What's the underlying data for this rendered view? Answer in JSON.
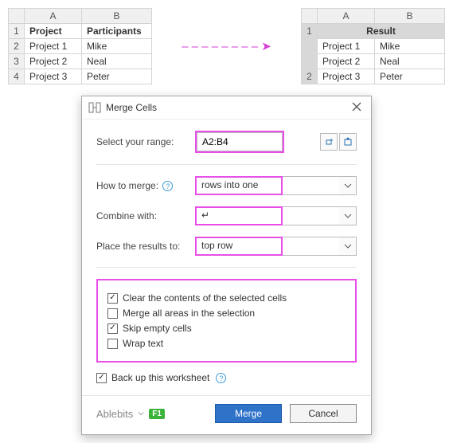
{
  "left_table": {
    "col_headers": [
      "",
      "A",
      "B"
    ],
    "rows": [
      {
        "n": "1",
        "a": "Project",
        "b": "Participants",
        "bold": true,
        "sel": false
      },
      {
        "n": "2",
        "a": "Project 1",
        "b": "Mike",
        "bold": false,
        "sel": false
      },
      {
        "n": "3",
        "a": "Project 2",
        "b": "Neal",
        "bold": false,
        "sel": false
      },
      {
        "n": "4",
        "a": "Project 3",
        "b": "Peter",
        "bold": false,
        "sel": false
      }
    ]
  },
  "arrow": "– – – – – – – – ➤",
  "right_table": {
    "col_headers": [
      "",
      "A",
      "B"
    ],
    "header_label": "Result",
    "rows": [
      {
        "n": "",
        "a": "Project 1",
        "b": "Mike"
      },
      {
        "n": "",
        "a": "Project 2",
        "b": "Neal"
      },
      {
        "n": "2",
        "a": "Project 3",
        "b": "Peter"
      }
    ],
    "header_row_n": "1"
  },
  "dialog": {
    "title": "Merge Cells",
    "range_label": "Select your range:",
    "range_value": "A2:B4",
    "how_label": "How to merge:",
    "how_value": "rows into one",
    "combine_label": "Combine with:",
    "combine_value": "↵",
    "place_label": "Place the results to:",
    "place_value": "top row",
    "checks": [
      {
        "label": "Clear the contents of the selected cells",
        "checked": true
      },
      {
        "label": "Merge all areas in the selection",
        "checked": false
      },
      {
        "label": "Skip empty cells",
        "checked": true
      },
      {
        "label": "Wrap text",
        "checked": false
      }
    ],
    "backup_label": "Back up this worksheet",
    "backup_checked": true,
    "brand": "Ablebits",
    "f1": "F1",
    "merge_btn": "Merge",
    "cancel_btn": "Cancel"
  }
}
